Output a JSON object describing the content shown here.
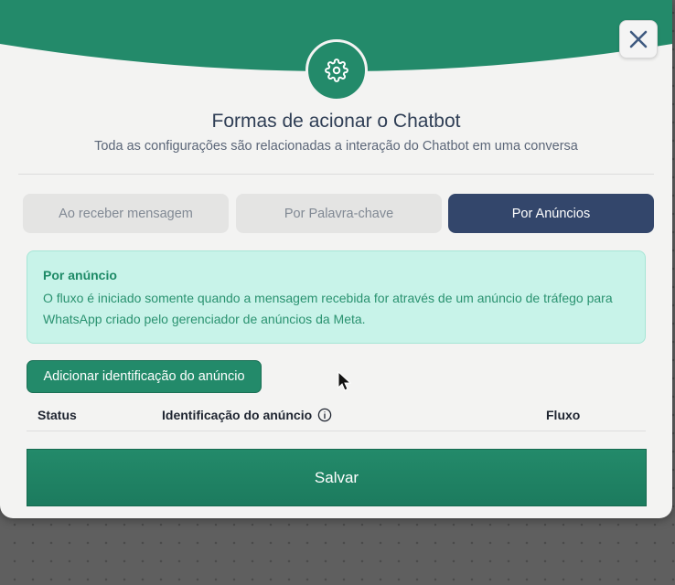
{
  "modal": {
    "title": "Formas de acionar o Chatbot",
    "subtitle": "Toda as configurações são relacionadas a interação do Chatbot em uma conversa"
  },
  "tabs": [
    {
      "label": "Ao receber mensagem",
      "active": false
    },
    {
      "label": "Por Palavra-chave",
      "active": false
    },
    {
      "label": "Por Anúncios",
      "active": true
    }
  ],
  "info": {
    "title": "Por anúncio",
    "text": "O fluxo é iniciado somente quando a mensagem recebida for através de um anúncio de tráfego para WhatsApp criado pelo gerenciador de anúncios da Meta."
  },
  "add_button_label": "Adicionar identificação do anúncio",
  "table": {
    "columns": [
      "Status",
      "Identificação do anúncio",
      "Fluxo"
    ]
  },
  "save_button_label": "Salvar",
  "icons": {
    "header": "gear-icon",
    "close": "close-icon",
    "column_info": "info-circle-icon"
  },
  "colors": {
    "primary_green": "#238a6a",
    "active_tab": "#33466b",
    "info_background": "#c8f3e9"
  }
}
